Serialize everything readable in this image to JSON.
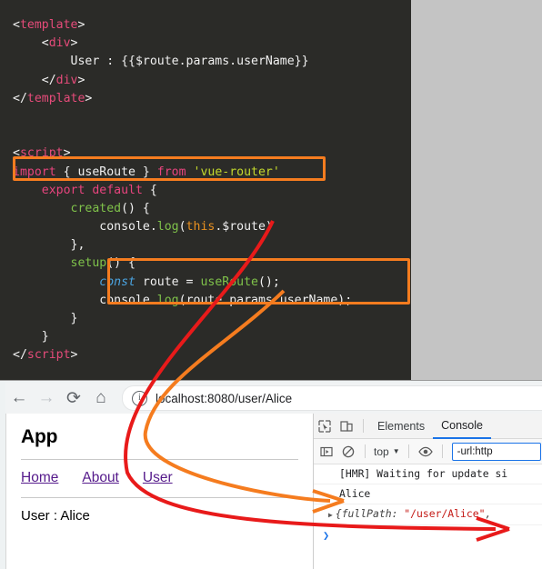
{
  "editor": {
    "lines": [
      [
        {
          "t": "<",
          "c": "punc"
        },
        {
          "t": "template",
          "c": "tag"
        },
        {
          "t": ">",
          "c": "punc"
        }
      ],
      [
        {
          "t": "    <",
          "c": "punc"
        },
        {
          "t": "div",
          "c": "tag"
        },
        {
          "t": ">",
          "c": "punc"
        }
      ],
      [
        {
          "t": "        User : {{$route.params.userName}}",
          "c": "plain"
        }
      ],
      [
        {
          "t": "    </",
          "c": "punc"
        },
        {
          "t": "div",
          "c": "tag"
        },
        {
          "t": ">",
          "c": "punc"
        }
      ],
      [
        {
          "t": "</",
          "c": "punc"
        },
        {
          "t": "template",
          "c": "tag"
        },
        {
          "t": ">",
          "c": "punc"
        }
      ],
      [
        {
          "t": "",
          "c": "plain"
        }
      ],
      [
        {
          "t": "",
          "c": "plain"
        }
      ],
      [
        {
          "t": "<",
          "c": "punc"
        },
        {
          "t": "script",
          "c": "tag"
        },
        {
          "t": ">",
          "c": "punc"
        }
      ],
      [
        {
          "t": "import",
          "c": "kw"
        },
        {
          "t": " { useRoute } ",
          "c": "plain"
        },
        {
          "t": "from",
          "c": "kw"
        },
        {
          "t": " ",
          "c": "plain"
        },
        {
          "t": "'vue-router'",
          "c": "str"
        }
      ],
      [
        {
          "t": "    ",
          "c": "plain"
        },
        {
          "t": "export default",
          "c": "kw"
        },
        {
          "t": " {",
          "c": "punc"
        }
      ],
      [
        {
          "t": "        ",
          "c": "plain"
        },
        {
          "t": "created",
          "c": "fn"
        },
        {
          "t": "() {",
          "c": "punc"
        }
      ],
      [
        {
          "t": "            console.",
          "c": "plain"
        },
        {
          "t": "log",
          "c": "fn"
        },
        {
          "t": "(",
          "c": "punc"
        },
        {
          "t": "this",
          "c": "orange"
        },
        {
          "t": ".$route)",
          "c": "plain"
        }
      ],
      [
        {
          "t": "        },",
          "c": "punc"
        }
      ],
      [
        {
          "t": "        ",
          "c": "plain"
        },
        {
          "t": "setup",
          "c": "fn"
        },
        {
          "t": "() {",
          "c": "punc"
        }
      ],
      [
        {
          "t": "            ",
          "c": "plain"
        },
        {
          "t": "const",
          "c": "constkw"
        },
        {
          "t": " route = ",
          "c": "plain"
        },
        {
          "t": "useRoute",
          "c": "fn"
        },
        {
          "t": "();",
          "c": "punc"
        }
      ],
      [
        {
          "t": "            console.",
          "c": "plain"
        },
        {
          "t": "log",
          "c": "fn"
        },
        {
          "t": "(route.params.userName);",
          "c": "plain"
        }
      ],
      [
        {
          "t": "        }",
          "c": "punc"
        }
      ],
      [
        {
          "t": "    }",
          "c": "punc"
        }
      ],
      [
        {
          "t": "</",
          "c": "punc"
        },
        {
          "t": "script",
          "c": "tag"
        },
        {
          "t": ">",
          "c": "punc"
        }
      ]
    ],
    "highlight_color": "#f57c1f",
    "background": "#2b2b28"
  },
  "browser": {
    "nav": {
      "back": "←",
      "forward": "→",
      "reload": "⟳",
      "home": "⌂"
    },
    "omnibox": {
      "info_icon": "i",
      "url": "localhost:8080/user/Alice"
    }
  },
  "page": {
    "title": "App",
    "links": [
      "Home",
      "About",
      "User"
    ],
    "content": "User : Alice"
  },
  "devtools": {
    "tabs": [
      {
        "label": "Elements",
        "active": false
      },
      {
        "label": "Console",
        "active": true
      }
    ],
    "toolbar": {
      "sidebar_icon": "▶",
      "clear_icon": "⊘",
      "context": "top",
      "context_caret": "▼",
      "eye_icon": "◉",
      "filter_value": "-url:http"
    },
    "console": {
      "messages": [
        {
          "type": "text",
          "text": "[HMR] Waiting for update si"
        },
        {
          "type": "text",
          "text": "Alice"
        },
        {
          "type": "object",
          "prefix": "{",
          "key": "fullPath",
          "sep": ": ",
          "value": "\"/user/Alice\"",
          "suffix": ","
        }
      ],
      "prompt": "❯"
    }
  },
  "annotations": {
    "red_arrow_color": "#e81a1a",
    "orange_arrow_color": "#f57c1f"
  }
}
